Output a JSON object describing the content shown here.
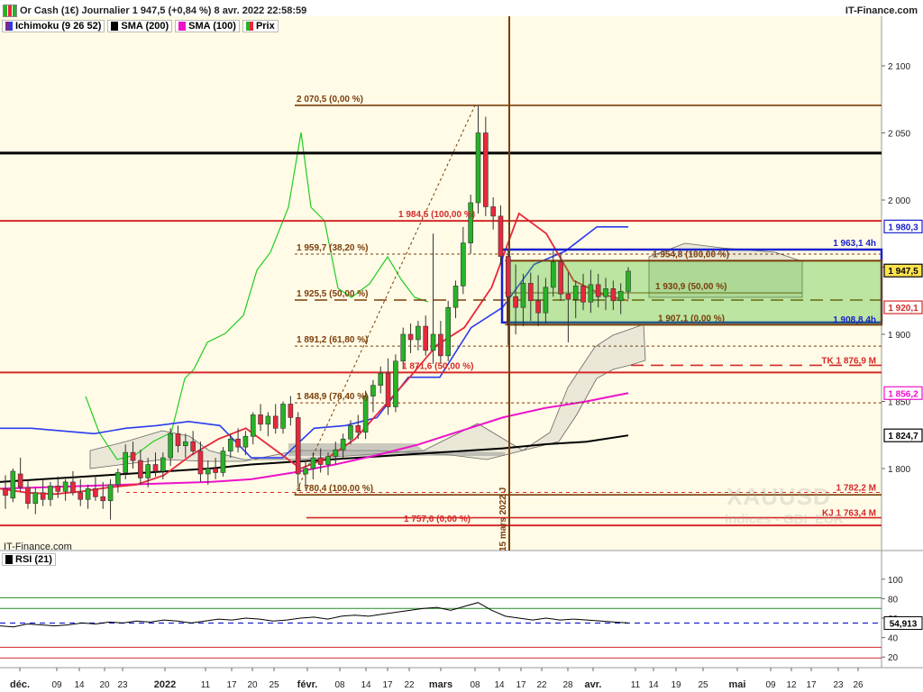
{
  "header": {
    "title": "Or Cash (1€) Journalier 1 947,5 (+0,84 %) 8 avr. 2022 22:58:59",
    "brand": "IT-Finance.com"
  },
  "legend": {
    "items": [
      {
        "label": "Ichimoku (9 26 52)",
        "color": "#7a2a8a"
      },
      {
        "label": "SMA (200)",
        "color": "#000000"
      },
      {
        "label": "SMA (100)",
        "color": "#ee11cc"
      },
      {
        "label": "Prix",
        "color": "#22aa22"
      }
    ]
  },
  "watermark": {
    "symbol": "XAUUSD",
    "subtitle": "Indices - GBI_EUR"
  },
  "footer_brand": "IT-Finance.com",
  "colors": {
    "bull": "#27b327",
    "bear": "#e8283c",
    "brown": "#7a3e0a",
    "red": "#d42a2a",
    "blue": "#1a22cc",
    "green_line": "#22cc22",
    "pink": "#ee11cc",
    "tenkan": "#e8283c",
    "kijun": "#2a3cf0",
    "panel_bg": "#fffbe6"
  },
  "chart_data": [
    {
      "type": "line",
      "title": "Or Cash (1€) Journalier",
      "y_axis": {
        "ticks": [
          1800,
          1850,
          1900,
          1950,
          2000,
          2050,
          2100
        ],
        "tick_labels": [
          "1 800",
          "1 850",
          "1 900",
          "1 950",
          "2 000",
          "2 050",
          "2 100"
        ],
        "range": [
          1740,
          2140
        ]
      },
      "x_axis": {
        "tick_labels": [
          "déc.",
          "09",
          "14",
          "20",
          "23",
          "2022",
          "11",
          "17",
          "20",
          "25",
          "févr.",
          "08",
          "14",
          "17",
          "22",
          "mars",
          "08",
          "14",
          "17",
          "22",
          "28",
          "avr.",
          "11",
          "14",
          "19",
          "25",
          "mai",
          "09",
          "12",
          "17",
          "23",
          "26"
        ]
      },
      "candles": [
        {
          "o": 1785,
          "h": 1795,
          "l": 1770,
          "c": 1780
        },
        {
          "o": 1778,
          "h": 1800,
          "l": 1775,
          "c": 1798
        },
        {
          "o": 1796,
          "h": 1808,
          "l": 1783,
          "c": 1786
        },
        {
          "o": 1786,
          "h": 1792,
          "l": 1770,
          "c": 1774
        },
        {
          "o": 1774,
          "h": 1786,
          "l": 1766,
          "c": 1782
        },
        {
          "o": 1782,
          "h": 1792,
          "l": 1772,
          "c": 1777
        },
        {
          "o": 1777,
          "h": 1790,
          "l": 1772,
          "c": 1787
        },
        {
          "o": 1787,
          "h": 1794,
          "l": 1778,
          "c": 1783
        },
        {
          "o": 1783,
          "h": 1792,
          "l": 1776,
          "c": 1790
        },
        {
          "o": 1790,
          "h": 1798,
          "l": 1780,
          "c": 1782
        },
        {
          "o": 1782,
          "h": 1792,
          "l": 1772,
          "c": 1777
        },
        {
          "o": 1777,
          "h": 1788,
          "l": 1770,
          "c": 1785
        },
        {
          "o": 1785,
          "h": 1795,
          "l": 1776,
          "c": 1779
        },
        {
          "o": 1779,
          "h": 1790,
          "l": 1770,
          "c": 1776
        },
        {
          "o": 1776,
          "h": 1792,
          "l": 1762,
          "c": 1788
        },
        {
          "o": 1788,
          "h": 1800,
          "l": 1782,
          "c": 1797
        },
        {
          "o": 1797,
          "h": 1818,
          "l": 1792,
          "c": 1812
        },
        {
          "o": 1812,
          "h": 1820,
          "l": 1800,
          "c": 1806
        },
        {
          "o": 1806,
          "h": 1814,
          "l": 1788,
          "c": 1793
        },
        {
          "o": 1793,
          "h": 1808,
          "l": 1786,
          "c": 1803
        },
        {
          "o": 1803,
          "h": 1812,
          "l": 1794,
          "c": 1798
        },
        {
          "o": 1798,
          "h": 1812,
          "l": 1792,
          "c": 1808
        },
        {
          "o": 1808,
          "h": 1830,
          "l": 1802,
          "c": 1826
        },
        {
          "o": 1826,
          "h": 1832,
          "l": 1812,
          "c": 1817
        },
        {
          "o": 1817,
          "h": 1826,
          "l": 1808,
          "c": 1820
        },
        {
          "o": 1820,
          "h": 1828,
          "l": 1810,
          "c": 1813
        },
        {
          "o": 1813,
          "h": 1820,
          "l": 1790,
          "c": 1796
        },
        {
          "o": 1796,
          "h": 1806,
          "l": 1788,
          "c": 1800
        },
        {
          "o": 1800,
          "h": 1808,
          "l": 1792,
          "c": 1797
        },
        {
          "o": 1797,
          "h": 1816,
          "l": 1794,
          "c": 1813
        },
        {
          "o": 1813,
          "h": 1826,
          "l": 1808,
          "c": 1822
        },
        {
          "o": 1822,
          "h": 1830,
          "l": 1812,
          "c": 1816
        },
        {
          "o": 1816,
          "h": 1828,
          "l": 1810,
          "c": 1824
        },
        {
          "o": 1824,
          "h": 1842,
          "l": 1818,
          "c": 1840
        },
        {
          "o": 1840,
          "h": 1848,
          "l": 1828,
          "c": 1833
        },
        {
          "o": 1833,
          "h": 1842,
          "l": 1824,
          "c": 1839
        },
        {
          "o": 1839,
          "h": 1848,
          "l": 1826,
          "c": 1830
        },
        {
          "o": 1830,
          "h": 1850,
          "l": 1826,
          "c": 1848
        },
        {
          "o": 1848,
          "h": 1854,
          "l": 1832,
          "c": 1838
        },
        {
          "o": 1838,
          "h": 1842,
          "l": 1788,
          "c": 1796
        },
        {
          "o": 1796,
          "h": 1806,
          "l": 1785,
          "c": 1800
        },
        {
          "o": 1800,
          "h": 1812,
          "l": 1792,
          "c": 1808
        },
        {
          "o": 1808,
          "h": 1815,
          "l": 1797,
          "c": 1803
        },
        {
          "o": 1803,
          "h": 1812,
          "l": 1795,
          "c": 1809
        },
        {
          "o": 1809,
          "h": 1820,
          "l": 1803,
          "c": 1814
        },
        {
          "o": 1814,
          "h": 1826,
          "l": 1808,
          "c": 1822
        },
        {
          "o": 1822,
          "h": 1836,
          "l": 1818,
          "c": 1832
        },
        {
          "o": 1832,
          "h": 1840,
          "l": 1822,
          "c": 1827
        },
        {
          "o": 1827,
          "h": 1858,
          "l": 1822,
          "c": 1854
        },
        {
          "o": 1854,
          "h": 1866,
          "l": 1842,
          "c": 1862
        },
        {
          "o": 1862,
          "h": 1876,
          "l": 1856,
          "c": 1871
        },
        {
          "o": 1871,
          "h": 1882,
          "l": 1840,
          "c": 1846
        },
        {
          "o": 1846,
          "h": 1885,
          "l": 1842,
          "c": 1880
        },
        {
          "o": 1880,
          "h": 1905,
          "l": 1874,
          "c": 1900
        },
        {
          "o": 1900,
          "h": 1908,
          "l": 1886,
          "c": 1896
        },
        {
          "o": 1896,
          "h": 1910,
          "l": 1888,
          "c": 1906
        },
        {
          "o": 1906,
          "h": 1914,
          "l": 1884,
          "c": 1888
        },
        {
          "o": 1888,
          "h": 1975,
          "l": 1878,
          "c": 1900
        },
        {
          "o": 1900,
          "h": 1910,
          "l": 1878,
          "c": 1884
        },
        {
          "o": 1884,
          "h": 1925,
          "l": 1880,
          "c": 1920
        },
        {
          "o": 1920,
          "h": 1940,
          "l": 1912,
          "c": 1936
        },
        {
          "o": 1936,
          "h": 1980,
          "l": 1930,
          "c": 1968
        },
        {
          "o": 1968,
          "h": 2004,
          "l": 1960,
          "c": 1998
        },
        {
          "o": 1998,
          "h": 2070,
          "l": 1990,
          "c": 2050
        },
        {
          "o": 2050,
          "h": 2062,
          "l": 1988,
          "c": 1995
        },
        {
          "o": 1995,
          "h": 2002,
          "l": 1978,
          "c": 1988
        },
        {
          "o": 1988,
          "h": 1996,
          "l": 1952,
          "c": 1958
        },
        {
          "o": 1958,
          "h": 1964,
          "l": 1892,
          "c": 1928
        },
        {
          "o": 1928,
          "h": 1952,
          "l": 1900,
          "c": 1920
        },
        {
          "o": 1920,
          "h": 1945,
          "l": 1906,
          "c": 1938
        },
        {
          "o": 1938,
          "h": 1946,
          "l": 1910,
          "c": 1925
        },
        {
          "o": 1925,
          "h": 1944,
          "l": 1906,
          "c": 1916
        },
        {
          "o": 1916,
          "h": 1942,
          "l": 1908,
          "c": 1935
        },
        {
          "o": 1935,
          "h": 1962,
          "l": 1928,
          "c": 1954
        },
        {
          "o": 1954,
          "h": 1960,
          "l": 1925,
          "c": 1930
        },
        {
          "o": 1930,
          "h": 1946,
          "l": 1894,
          "c": 1926
        },
        {
          "o": 1926,
          "h": 1940,
          "l": 1912,
          "c": 1936
        },
        {
          "o": 1936,
          "h": 1945,
          "l": 1918,
          "c": 1924
        },
        {
          "o": 1924,
          "h": 1948,
          "l": 1916,
          "c": 1937
        },
        {
          "o": 1937,
          "h": 1945,
          "l": 1920,
          "c": 1928
        },
        {
          "o": 1928,
          "h": 1942,
          "l": 1918,
          "c": 1934
        },
        {
          "o": 1934,
          "h": 1940,
          "l": 1918,
          "c": 1925
        },
        {
          "o": 1925,
          "h": 1938,
          "l": 1915,
          "c": 1932
        },
        {
          "o": 1932,
          "h": 1950,
          "l": 1926,
          "c": 1947
        }
      ],
      "fibonacci_levels": [
        {
          "label": "2 070,5 (0,00 %)",
          "value": 2070.5
        },
        {
          "label": "1 984,5 (100,00 %)",
          "value": 1984.5
        },
        {
          "label": "1 959,7 (38,20 %)",
          "value": 1959.7
        },
        {
          "label": "1 954,8 (100,00 %)",
          "value": 1954.8
        },
        {
          "label": "1 930,9 (50,00 %)",
          "value": 1930.9
        },
        {
          "label": "1 925,5 (50,00 %)",
          "value": 1925.5
        },
        {
          "label": "1 907,1 (0,00 %)",
          "value": 1907.1
        },
        {
          "label": "1 891,2 (61,80 %)",
          "value": 1891.2
        },
        {
          "label": "1 871,6 (50,00 %)",
          "value": 1871.6
        },
        {
          "label": "1 848,9 (76,40 %)",
          "value": 1848.9
        },
        {
          "label": "1 780,4 (100,00 %)",
          "value": 1780.4
        },
        {
          "label": "1 757,6 (0,00 %)",
          "value": 1757.6
        }
      ],
      "right_labels": [
        {
          "label": "1 963,1 4h",
          "value": 1963.1
        },
        {
          "label": "1 908,8 4h",
          "value": 1908.8
        },
        {
          "label": "TK 1 876,9 M",
          "value": 1876.9
        },
        {
          "label": "1 782,2 M",
          "value": 1782.2
        },
        {
          "label": "KJ 1 763,4 M",
          "value": 1763.4
        }
      ],
      "price_tags": [
        {
          "label": "1 980,3",
          "value": 1980.3
        },
        {
          "label": "1 947,5",
          "value": 1947.5
        },
        {
          "label": "1 920,1",
          "value": 1920.1
        },
        {
          "label": "1 856,2",
          "value": 1856.2
        },
        {
          "label": "1 824,7",
          "value": 1824.7
        }
      ],
      "horizontal_levels": {
        "black": 2035,
        "red": [
          1984.5,
          1871.6,
          1757.6
        ]
      },
      "vertical_marker": {
        "label": "15 mars 2022 J"
      },
      "sma200": [
        1790,
        1792,
        1794,
        1796,
        1798,
        1800,
        1803,
        1805,
        1807,
        1809,
        1811,
        1813,
        1815,
        1818,
        1820,
        1824.7
      ],
      "sma100": [
        1785,
        1786,
        1787,
        1788,
        1789,
        1790,
        1792,
        1797,
        1803,
        1810,
        1818,
        1828,
        1838,
        1845,
        1850,
        1856.2
      ],
      "tenkan": [
        1785,
        1782,
        1781,
        1783,
        1786,
        1788,
        1795,
        1810,
        1822,
        1830,
        1815,
        1800,
        1808,
        1822,
        1845,
        1868,
        1892,
        1905,
        1935,
        1990,
        1975,
        1940,
        1930,
        1925
      ],
      "kijun": [
        1830,
        1830,
        1828,
        1826,
        1830,
        1832,
        1835,
        1832,
        1808,
        1808,
        1830,
        1832,
        1838,
        1868,
        1868,
        1905,
        1920,
        1952,
        1962,
        1980,
        1980
      ]
    },
    {
      "type": "line",
      "title": "RSI (21)",
      "y_axis": {
        "ticks": [
          20,
          40,
          60,
          80,
          100
        ],
        "tick_labels": [
          "20",
          "40",
          "60",
          "80",
          "100"
        ],
        "range": [
          10,
          110
        ]
      },
      "levels": [
        70,
        54.913,
        30
      ],
      "last_value_label": "54,913",
      "values": [
        52,
        51,
        54,
        53,
        52,
        53,
        55,
        54,
        56,
        55,
        57,
        56,
        58,
        57,
        55,
        57,
        59,
        58,
        60,
        59,
        57,
        58,
        60,
        61,
        59,
        62,
        63,
        62,
        64,
        66,
        68,
        70,
        71,
        68,
        72,
        76,
        68,
        62,
        60,
        58,
        60,
        58,
        59,
        58,
        57,
        56,
        55
      ]
    }
  ]
}
